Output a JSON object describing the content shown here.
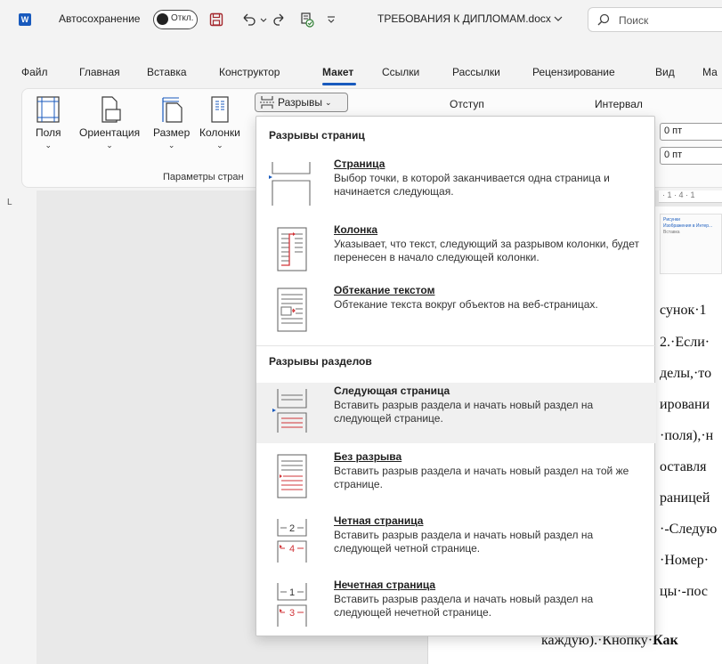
{
  "titlebar": {
    "app_logo": "W",
    "autosave_label": "Автосохранение",
    "autosave_state": "Откл.",
    "doc_title": "ТРЕБОВАНИЯ К ДИПЛОМАМ.docx",
    "search_placeholder": "Поиск"
  },
  "tabs": [
    {
      "label": "Файл"
    },
    {
      "label": "Главная"
    },
    {
      "label": "Вставка"
    },
    {
      "label": "Конструктор"
    },
    {
      "label": "Макет",
      "active": true
    },
    {
      "label": "Ссылки"
    },
    {
      "label": "Рассылки"
    },
    {
      "label": "Рецензирование"
    },
    {
      "label": "Вид"
    },
    {
      "label": "Ма"
    }
  ],
  "ribbon": {
    "fields_label": "Поля",
    "orientation_label": "Ориентация",
    "size_label": "Размер",
    "columns_label": "Колонки",
    "group_label": "Параметры стран",
    "breaks_label": "Разрывы",
    "indent_label": "Отступ",
    "spacing_label": "Интервал",
    "spacing_before": "0 пт",
    "spacing_after": "0 пт"
  },
  "ruler": {
    "corner": "L",
    "ticks": "· 1 · 4 · 1"
  },
  "thumbnail": {
    "line1": "Рисунки",
    "line2": "Изображения в Интер...",
    "line3": "Вставка"
  },
  "document": {
    "lines": [
      "сунок·1",
      "2.·Если·",
      "делы,·то",
      "ировани",
      "·поля),·н",
      "оставля",
      "раницей",
      "·-Следую",
      "·Номер·",
      "цы·-пос",
      "каждую).·Кнопку·",
      "Как"
    ]
  },
  "menu": {
    "page_breaks_header": "Разрывы страниц",
    "section_breaks_header": "Разрывы разделов",
    "items": [
      {
        "title": "Страница",
        "desc": "Выбор точки, в которой заканчивается одна страница и начинается следующая."
      },
      {
        "title": "Колонка",
        "desc": "Указывает, что текст, следующий за разрывом колонки, будет перенесен в начало следующей колонки."
      },
      {
        "title": "Обтекание текстом",
        "desc": "Обтекание текста вокруг объектов на веб-страницах."
      },
      {
        "title": "Следующая страница",
        "desc": "Вставить разрыв раздела и начать новый раздел на следующей странице."
      },
      {
        "title": "Без разрыва",
        "desc": "Вставить разрыв раздела и начать новый раздел на той же странице."
      },
      {
        "title": "Четная страница",
        "desc": "Вставить разрыв раздела и начать новый раздел на следующей четной странице."
      },
      {
        "title": "Нечетная страница",
        "desc": "Вставить разрыв раздела и начать новый раздел на следующей нечетной странице."
      }
    ]
  },
  "icon_digits": {
    "even_top": "2",
    "even_bottom": "4",
    "odd_top": "1",
    "odd_bottom": "3"
  },
  "colors": {
    "accent": "#185abd",
    "break_red": "#d13438"
  }
}
